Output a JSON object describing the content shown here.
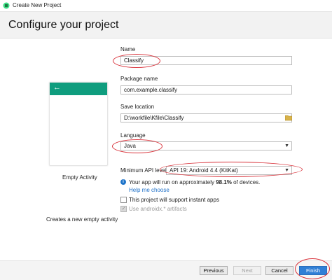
{
  "window": {
    "title": "Create New Project",
    "icon": "android-studio-icon"
  },
  "header": {
    "heading": "Configure your project"
  },
  "template": {
    "name": "Empty Activity",
    "description": "Creates a new empty activity",
    "preview_accent": "#0f9d7e",
    "back_icon": "arrow-left-icon"
  },
  "form": {
    "name": {
      "label": "Name",
      "value": "Classify"
    },
    "package": {
      "label": "Package name",
      "value": "com.example.classify"
    },
    "save_location": {
      "label": "Save location",
      "value": "D:\\workfile\\Kfile\\Classify"
    },
    "language": {
      "label": "Language",
      "value": "Java"
    },
    "min_api": {
      "label": "Minimum API level",
      "value": "API 19: Android 4.4 (KitKat)"
    },
    "info": {
      "prefix": "Your app will run on approximately ",
      "percent": "98.1%",
      "suffix": " of devices."
    },
    "help_link": "Help me choose",
    "instant_apps": {
      "label": "This project will support instant apps",
      "checked": false
    },
    "androidx": {
      "label": "Use androidx.* artifacts",
      "checked": true,
      "disabled": true
    }
  },
  "buttons": {
    "previous": "Previous",
    "next": "Next",
    "cancel": "Cancel",
    "finish": "Finish"
  },
  "colors": {
    "accent": "#2f7fd6",
    "annotation": "#d9343c",
    "link": "#1d6fc7"
  }
}
